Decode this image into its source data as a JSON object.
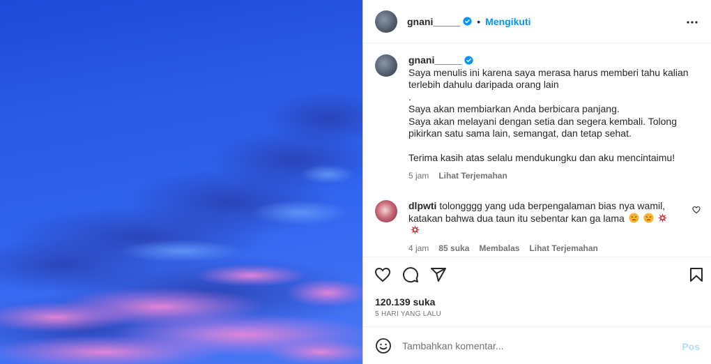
{
  "header": {
    "username": "gnani_____",
    "separator": "•",
    "follow_label": "Mengikuti"
  },
  "caption": {
    "username": "gnani_____",
    "lines": [
      "Saya menulis ini karena saya merasa harus memberi tahu kalian",
      "terlebih dahulu daripada orang lain",
      ".",
      "Saya akan membiarkan Anda berbicara panjang.",
      "Saya akan melayani dengan setia dan segera kembali. Tolong",
      "pikirkan satu sama lain, semangat, dan tetap sehat.",
      "",
      "Terima kasih atas selalu mendukungku dan aku mencintaimu!"
    ],
    "time": "5 jam",
    "translate_label": "Lihat Terjemahan"
  },
  "comment": {
    "username": "dlpwti",
    "text": "tolongggg yang uda berpengalaman bias nya wamil, katakan bahwa dua taun itu sebentar kan ga lama",
    "emojis": [
      "angry-face",
      "angry-face",
      "anger-symbol",
      "anger-symbol"
    ],
    "time": "4 jam",
    "likes": "85 suka",
    "reply_label": "Membalas",
    "translate_label": "Lihat Terjemahan"
  },
  "stats": {
    "likes": "120.139 suka",
    "date": "5 HARI YANG LALU"
  },
  "add_comment": {
    "placeholder": "Tambahkan komentar...",
    "post_label": "Pos"
  },
  "colors": {
    "accent": "#0095f6",
    "post_disabled": "#b3dbff",
    "text": "#262626",
    "muted": "#737373"
  }
}
